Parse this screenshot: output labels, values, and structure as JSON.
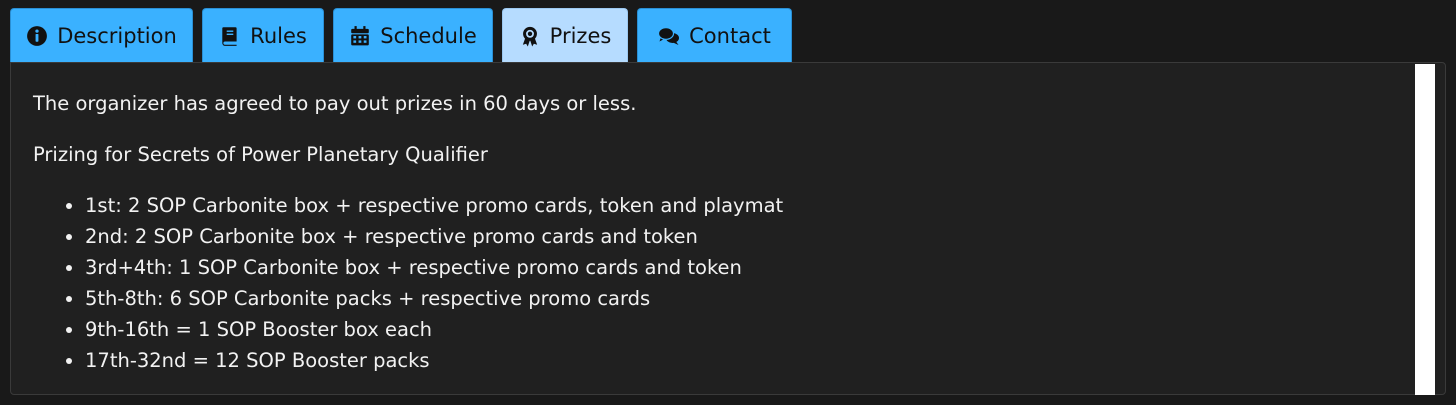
{
  "tabs": [
    {
      "label": "Description",
      "icon": "info-circle-icon"
    },
    {
      "label": "Rules",
      "icon": "book-icon"
    },
    {
      "label": "Schedule",
      "icon": "calendar-icon"
    },
    {
      "label": "Prizes",
      "icon": "award-icon",
      "active": true
    },
    {
      "label": "Contact",
      "icon": "comments-icon"
    }
  ],
  "colors": {
    "tab_bg": "#3ab1ff",
    "tab_active_bg": "#b6dcff",
    "panel_bg": "#202020",
    "page_bg": "#191919",
    "text": "#f2f2f2"
  },
  "prizes": {
    "payout_note": "The organizer has agreed to pay out prizes in 60 days or less.",
    "heading": "Prizing for Secrets of Power Planetary Qualifier",
    "items": [
      "1st: 2 SOP Carbonite box + respective promo cards, token and playmat",
      "2nd: 2 SOP Carbonite box + respective promo cards and token",
      "3rd+4th: 1 SOP Carbonite box + respective promo cards and token",
      "5th-8th: 6 SOP Carbonite packs + respective promo cards",
      "9th-16th = 1 SOP Booster box each",
      "17th-32nd = 12 SOP Booster packs"
    ]
  }
}
